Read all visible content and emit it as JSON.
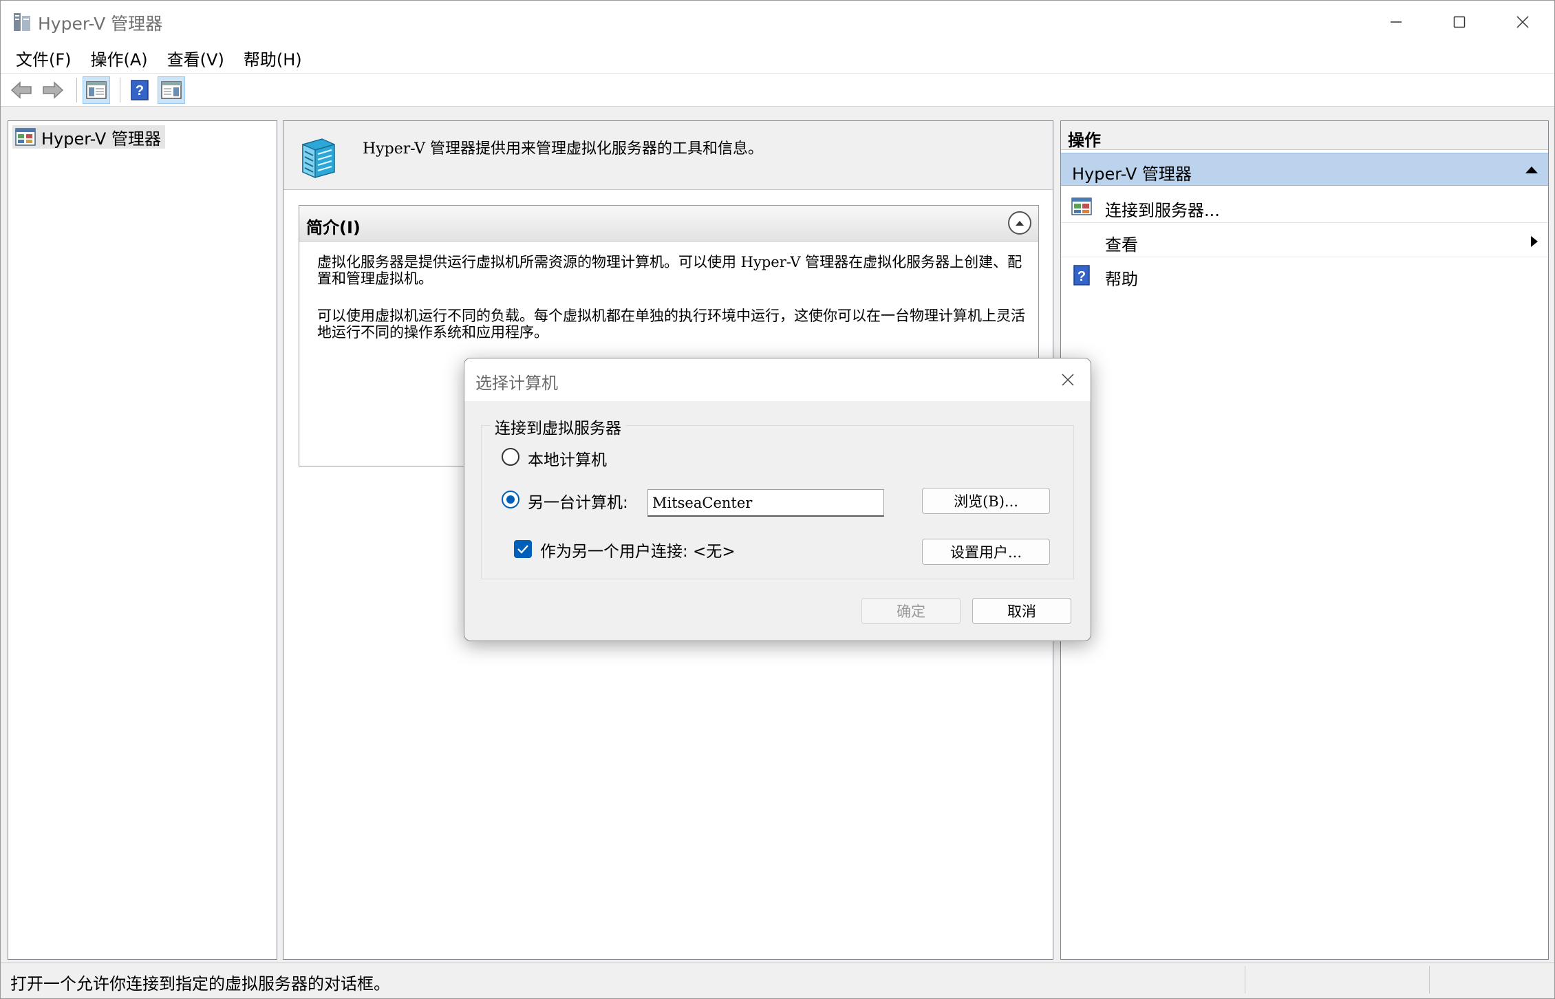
{
  "window": {
    "title": "Hyper-V 管理器"
  },
  "menu": {
    "items": [
      "文件(F)",
      "操作(A)",
      "查看(V)",
      "帮助(H)"
    ]
  },
  "toolbar": {
    "icons": [
      "back-arrow-icon",
      "forward-arrow-icon",
      "show-hide-console-tree-icon",
      "help-icon",
      "show-hide-action-pane-icon"
    ]
  },
  "tree": {
    "root_label": "Hyper-V 管理器"
  },
  "center": {
    "header_text": "Hyper-V 管理器提供用来管理虚拟化服务器的工具和信息。",
    "intro_title": "简介(I)",
    "intro_p1": "虚拟化服务器是提供运行虚拟机所需资源的物理计算机。可以使用 Hyper-V 管理器在虚拟化服务器上创建、配置和管理虚拟机。",
    "intro_p2": "可以使用虚拟机运行不同的负载。每个虚拟机都在单独的执行环境中运行，这使你可以在一台物理计算机上灵活地运行不同的操作系统和应用程序。"
  },
  "actions": {
    "title": "操作",
    "section": "Hyper-V 管理器",
    "items": {
      "connect": "连接到服务器...",
      "view": "查看",
      "help": "帮助"
    }
  },
  "status": {
    "text": "打开一个允许你连接到指定的虚拟服务器的对话框。"
  },
  "dialog": {
    "title": "选择计算机",
    "group_label": "连接到虚拟服务器",
    "radio_local": "本地计算机",
    "radio_other": "另一台计算机:",
    "selected_radio": "another-computer",
    "computer_name": "MitseaCenter",
    "browse_label": "浏览(B)...",
    "connect_as_label": "作为另一个用户连接: <无>",
    "connect_as_checked": true,
    "set_user_label": "设置用户...",
    "ok_label": "确定",
    "cancel_label": "取消"
  },
  "colors": {
    "accent": "#005fb8",
    "section_bg": "#bcd3ee",
    "disabled_text": "#9a9a9a"
  }
}
